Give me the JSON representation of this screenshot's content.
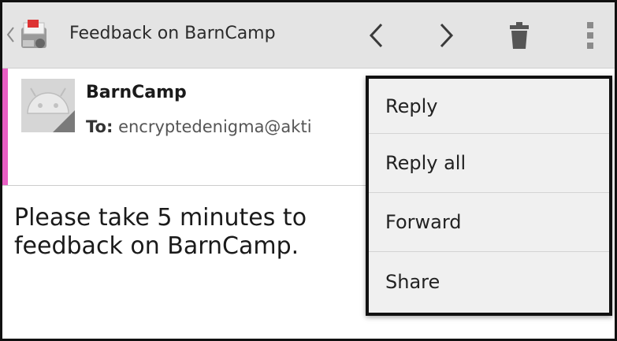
{
  "action_bar": {
    "title": "Feedback on BarnCamp",
    "icons": {
      "up": "chevron-left-small-icon",
      "app": "gmail-icon",
      "prev": "chevron-left-icon",
      "next": "chevron-right-icon",
      "delete": "trash-icon",
      "overflow": "more-vert-icon"
    }
  },
  "message": {
    "sender": "BarnCamp",
    "to_label": "To:",
    "to_address": "encryptedenigma@akti",
    "body_lines": [
      "Please take 5 minutes to",
      "feedback on BarnCamp."
    ],
    "accent_color": "#e85fc4"
  },
  "overflow_menu": {
    "items": [
      "Reply",
      "Reply all",
      "Forward",
      "Share"
    ]
  }
}
